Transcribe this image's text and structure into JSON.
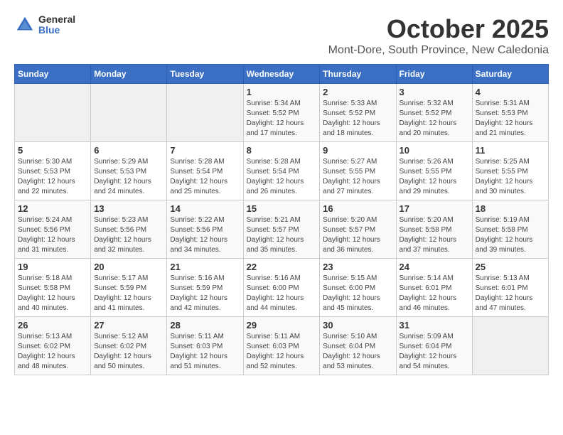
{
  "header": {
    "logo_general": "General",
    "logo_blue": "Blue",
    "title": "October 2025",
    "subtitle": "Mont-Dore, South Province, New Caledonia"
  },
  "weekdays": [
    "Sunday",
    "Monday",
    "Tuesday",
    "Wednesday",
    "Thursday",
    "Friday",
    "Saturday"
  ],
  "weeks": [
    [
      {
        "day": "",
        "info": ""
      },
      {
        "day": "",
        "info": ""
      },
      {
        "day": "",
        "info": ""
      },
      {
        "day": "1",
        "info": "Sunrise: 5:34 AM\nSunset: 5:52 PM\nDaylight: 12 hours and 17 minutes."
      },
      {
        "day": "2",
        "info": "Sunrise: 5:33 AM\nSunset: 5:52 PM\nDaylight: 12 hours and 18 minutes."
      },
      {
        "day": "3",
        "info": "Sunrise: 5:32 AM\nSunset: 5:52 PM\nDaylight: 12 hours and 20 minutes."
      },
      {
        "day": "4",
        "info": "Sunrise: 5:31 AM\nSunset: 5:53 PM\nDaylight: 12 hours and 21 minutes."
      }
    ],
    [
      {
        "day": "5",
        "info": "Sunrise: 5:30 AM\nSunset: 5:53 PM\nDaylight: 12 hours and 22 minutes."
      },
      {
        "day": "6",
        "info": "Sunrise: 5:29 AM\nSunset: 5:53 PM\nDaylight: 12 hours and 24 minutes."
      },
      {
        "day": "7",
        "info": "Sunrise: 5:28 AM\nSunset: 5:54 PM\nDaylight: 12 hours and 25 minutes."
      },
      {
        "day": "8",
        "info": "Sunrise: 5:28 AM\nSunset: 5:54 PM\nDaylight: 12 hours and 26 minutes."
      },
      {
        "day": "9",
        "info": "Sunrise: 5:27 AM\nSunset: 5:55 PM\nDaylight: 12 hours and 27 minutes."
      },
      {
        "day": "10",
        "info": "Sunrise: 5:26 AM\nSunset: 5:55 PM\nDaylight: 12 hours and 29 minutes."
      },
      {
        "day": "11",
        "info": "Sunrise: 5:25 AM\nSunset: 5:55 PM\nDaylight: 12 hours and 30 minutes."
      }
    ],
    [
      {
        "day": "12",
        "info": "Sunrise: 5:24 AM\nSunset: 5:56 PM\nDaylight: 12 hours and 31 minutes."
      },
      {
        "day": "13",
        "info": "Sunrise: 5:23 AM\nSunset: 5:56 PM\nDaylight: 12 hours and 32 minutes."
      },
      {
        "day": "14",
        "info": "Sunrise: 5:22 AM\nSunset: 5:56 PM\nDaylight: 12 hours and 34 minutes."
      },
      {
        "day": "15",
        "info": "Sunrise: 5:21 AM\nSunset: 5:57 PM\nDaylight: 12 hours and 35 minutes."
      },
      {
        "day": "16",
        "info": "Sunrise: 5:20 AM\nSunset: 5:57 PM\nDaylight: 12 hours and 36 minutes."
      },
      {
        "day": "17",
        "info": "Sunrise: 5:20 AM\nSunset: 5:58 PM\nDaylight: 12 hours and 37 minutes."
      },
      {
        "day": "18",
        "info": "Sunrise: 5:19 AM\nSunset: 5:58 PM\nDaylight: 12 hours and 39 minutes."
      }
    ],
    [
      {
        "day": "19",
        "info": "Sunrise: 5:18 AM\nSunset: 5:58 PM\nDaylight: 12 hours and 40 minutes."
      },
      {
        "day": "20",
        "info": "Sunrise: 5:17 AM\nSunset: 5:59 PM\nDaylight: 12 hours and 41 minutes."
      },
      {
        "day": "21",
        "info": "Sunrise: 5:16 AM\nSunset: 5:59 PM\nDaylight: 12 hours and 42 minutes."
      },
      {
        "day": "22",
        "info": "Sunrise: 5:16 AM\nSunset: 6:00 PM\nDaylight: 12 hours and 44 minutes."
      },
      {
        "day": "23",
        "info": "Sunrise: 5:15 AM\nSunset: 6:00 PM\nDaylight: 12 hours and 45 minutes."
      },
      {
        "day": "24",
        "info": "Sunrise: 5:14 AM\nSunset: 6:01 PM\nDaylight: 12 hours and 46 minutes."
      },
      {
        "day": "25",
        "info": "Sunrise: 5:13 AM\nSunset: 6:01 PM\nDaylight: 12 hours and 47 minutes."
      }
    ],
    [
      {
        "day": "26",
        "info": "Sunrise: 5:13 AM\nSunset: 6:02 PM\nDaylight: 12 hours and 48 minutes."
      },
      {
        "day": "27",
        "info": "Sunrise: 5:12 AM\nSunset: 6:02 PM\nDaylight: 12 hours and 50 minutes."
      },
      {
        "day": "28",
        "info": "Sunrise: 5:11 AM\nSunset: 6:03 PM\nDaylight: 12 hours and 51 minutes."
      },
      {
        "day": "29",
        "info": "Sunrise: 5:11 AM\nSunset: 6:03 PM\nDaylight: 12 hours and 52 minutes."
      },
      {
        "day": "30",
        "info": "Sunrise: 5:10 AM\nSunset: 6:04 PM\nDaylight: 12 hours and 53 minutes."
      },
      {
        "day": "31",
        "info": "Sunrise: 5:09 AM\nSunset: 6:04 PM\nDaylight: 12 hours and 54 minutes."
      },
      {
        "day": "",
        "info": ""
      }
    ]
  ]
}
